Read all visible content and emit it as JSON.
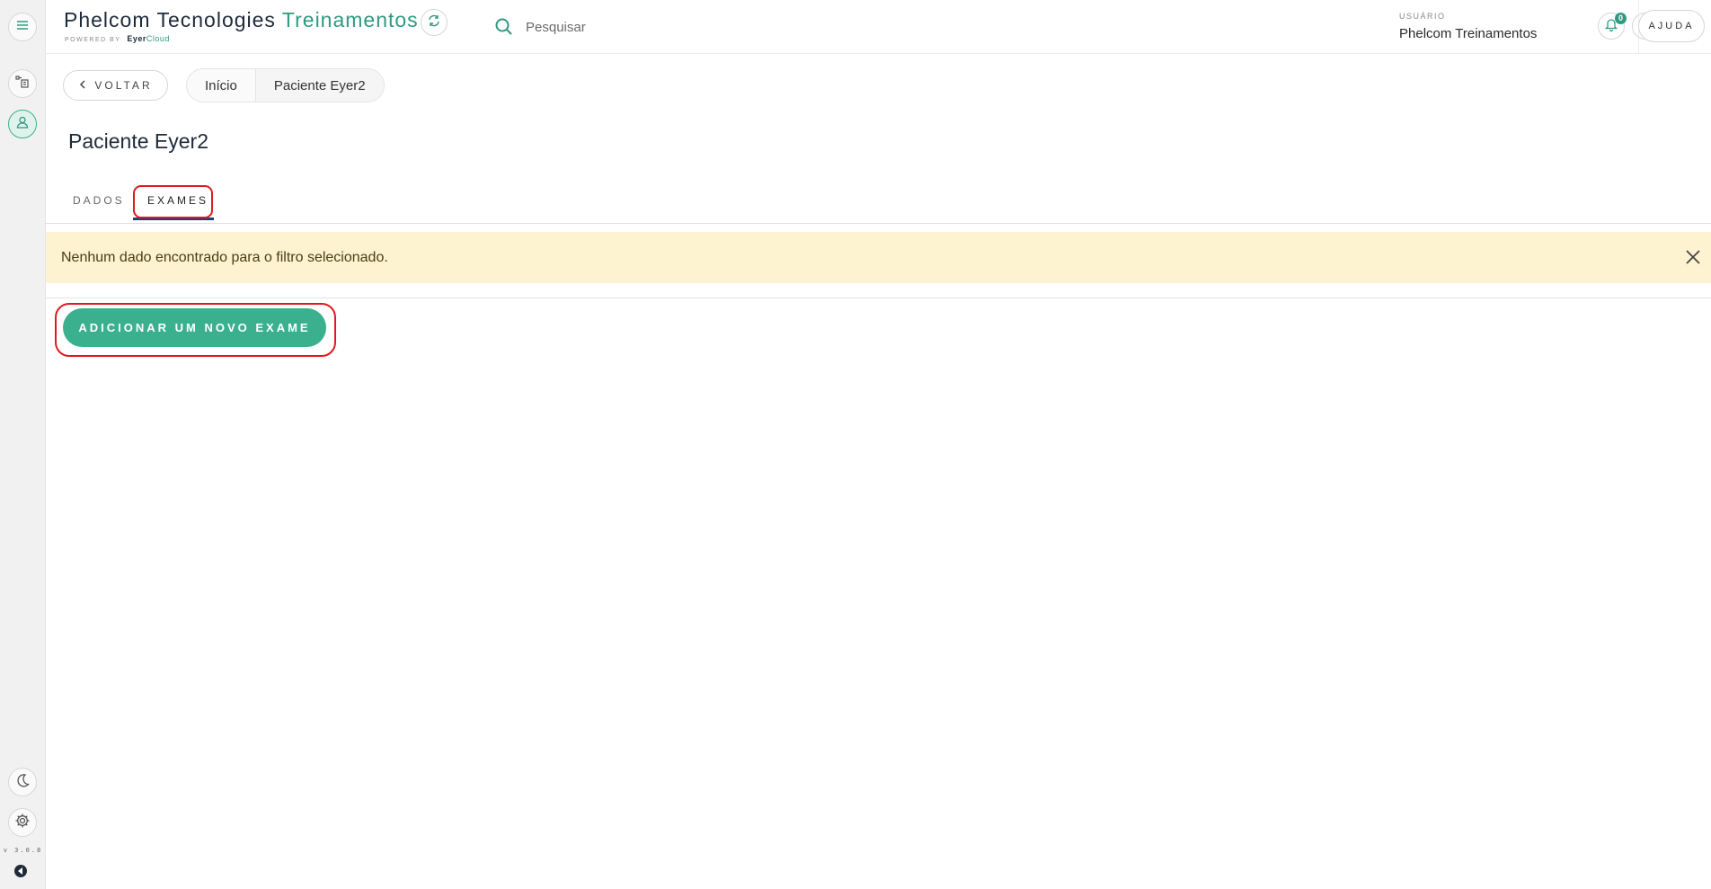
{
  "app": {
    "title_main": "Phelcom Tecnologies",
    "title_accent": "Treinamentos",
    "powered_by_label": "POWERED BY",
    "powered_brand": "Eyer",
    "powered_brand_cloud": "Cloud"
  },
  "search": {
    "placeholder": "Pesquisar"
  },
  "user": {
    "caption": "USUÁRIO",
    "name": "Phelcom Treinamentos",
    "notification_count": "0"
  },
  "header": {
    "help_label": "AJUDA"
  },
  "sidebar": {
    "version": "v 3.0.8"
  },
  "breadcrumb": {
    "back_label": "VOLTAR",
    "items": [
      "Início",
      "Paciente Eyer2"
    ]
  },
  "page": {
    "title": "Paciente Eyer2"
  },
  "tabs": [
    {
      "label": "DADOS",
      "active": false
    },
    {
      "label": "EXAMES",
      "active": true
    }
  ],
  "alert": {
    "message": "Nenhum dado encontrado para o filtro selecionado."
  },
  "actions": {
    "add_exam_label": "ADICIONAR UM NOVO EXAME"
  },
  "colors": {
    "accent": "#3bb08f",
    "alert_bg": "#fdf3d0",
    "highlight": "#e0191f"
  }
}
